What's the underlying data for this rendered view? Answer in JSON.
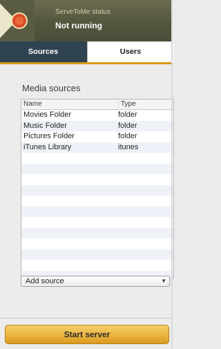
{
  "header": {
    "status_title": "ServeToMe status",
    "status_value": "Not running",
    "logo_icon": "servetome-logo-icon"
  },
  "tabs": [
    {
      "label": "Sources",
      "selected": true
    },
    {
      "label": "Users",
      "selected": false
    }
  ],
  "media": {
    "title": "Media sources",
    "columns": [
      "Name",
      "Type"
    ],
    "rows": [
      {
        "name": "Movies Folder",
        "type": "folder"
      },
      {
        "name": "Music Folder",
        "type": "folder"
      },
      {
        "name": "Pictures Folder",
        "type": "folder"
      },
      {
        "name": "iTunes Library",
        "type": "itunes"
      }
    ]
  },
  "add_source": {
    "label": "Add source"
  },
  "start_button": {
    "label": "Start server"
  },
  "colors": {
    "header_bg": "#54563f",
    "tab_selected_bg": "#2f4250",
    "tab_underline": "#d59b15",
    "button_gold": "#eab43f"
  }
}
